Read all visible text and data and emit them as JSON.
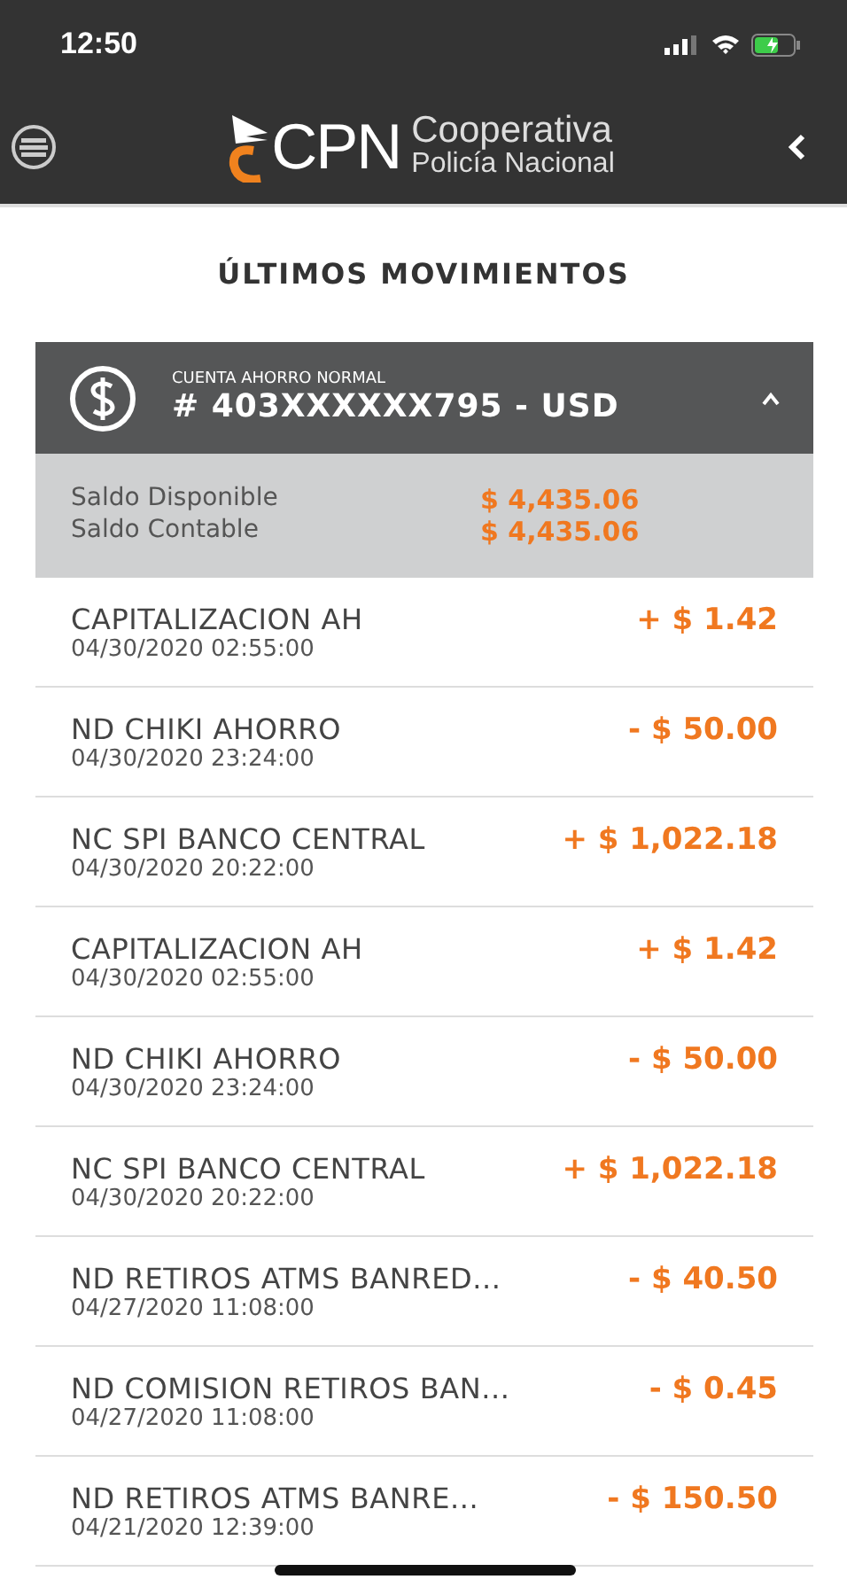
{
  "status_bar": {
    "time": "12:50"
  },
  "header": {
    "logo_letters": "CPN",
    "logo_line1": "Cooperativa",
    "logo_line2": "Policía Nacional"
  },
  "page_title": "ÚLTIMOS MOVIMIENTOS",
  "account": {
    "type": "CUENTA AHORRO NORMAL",
    "number": "# 403XXXXXX795 - USD",
    "expanded": true,
    "balances": [
      {
        "label": "Saldo Disponible",
        "amount": "$ 4,435.06"
      },
      {
        "label": "Saldo Contable",
        "amount": "$ 4,435.06"
      }
    ]
  },
  "movements": [
    {
      "description": "CAPITALIZACION AH",
      "date": "04/30/2020 02:55:00",
      "amount": "+ $ 1.42"
    },
    {
      "description": "ND CHIKI AHORRO",
      "date": "04/30/2020 23:24:00",
      "amount": "- $ 50.00"
    },
    {
      "description": "NC SPI BANCO CENTRAL",
      "date": "04/30/2020 20:22:00",
      "amount": "+ $ 1,022.18"
    },
    {
      "description": "CAPITALIZACION AH",
      "date": "04/30/2020 02:55:00",
      "amount": "+ $ 1.42"
    },
    {
      "description": "ND CHIKI AHORRO",
      "date": "04/30/2020 23:24:00",
      "amount": "- $ 50.00"
    },
    {
      "description": "NC SPI BANCO CENTRAL",
      "date": "04/30/2020 20:22:00",
      "amount": "+ $ 1,022.18"
    },
    {
      "description": "ND RETIROS ATMS BANRED...",
      "date": "04/27/2020 11:08:00",
      "amount": "- $ 40.50"
    },
    {
      "description": "ND COMISION RETIROS BAN...",
      "date": "04/27/2020 11:08:00",
      "amount": "- $ 0.45"
    },
    {
      "description": "ND RETIROS ATMS BANRE...",
      "date": "04/21/2020 12:39:00",
      "amount": "- $ 150.50"
    }
  ]
}
